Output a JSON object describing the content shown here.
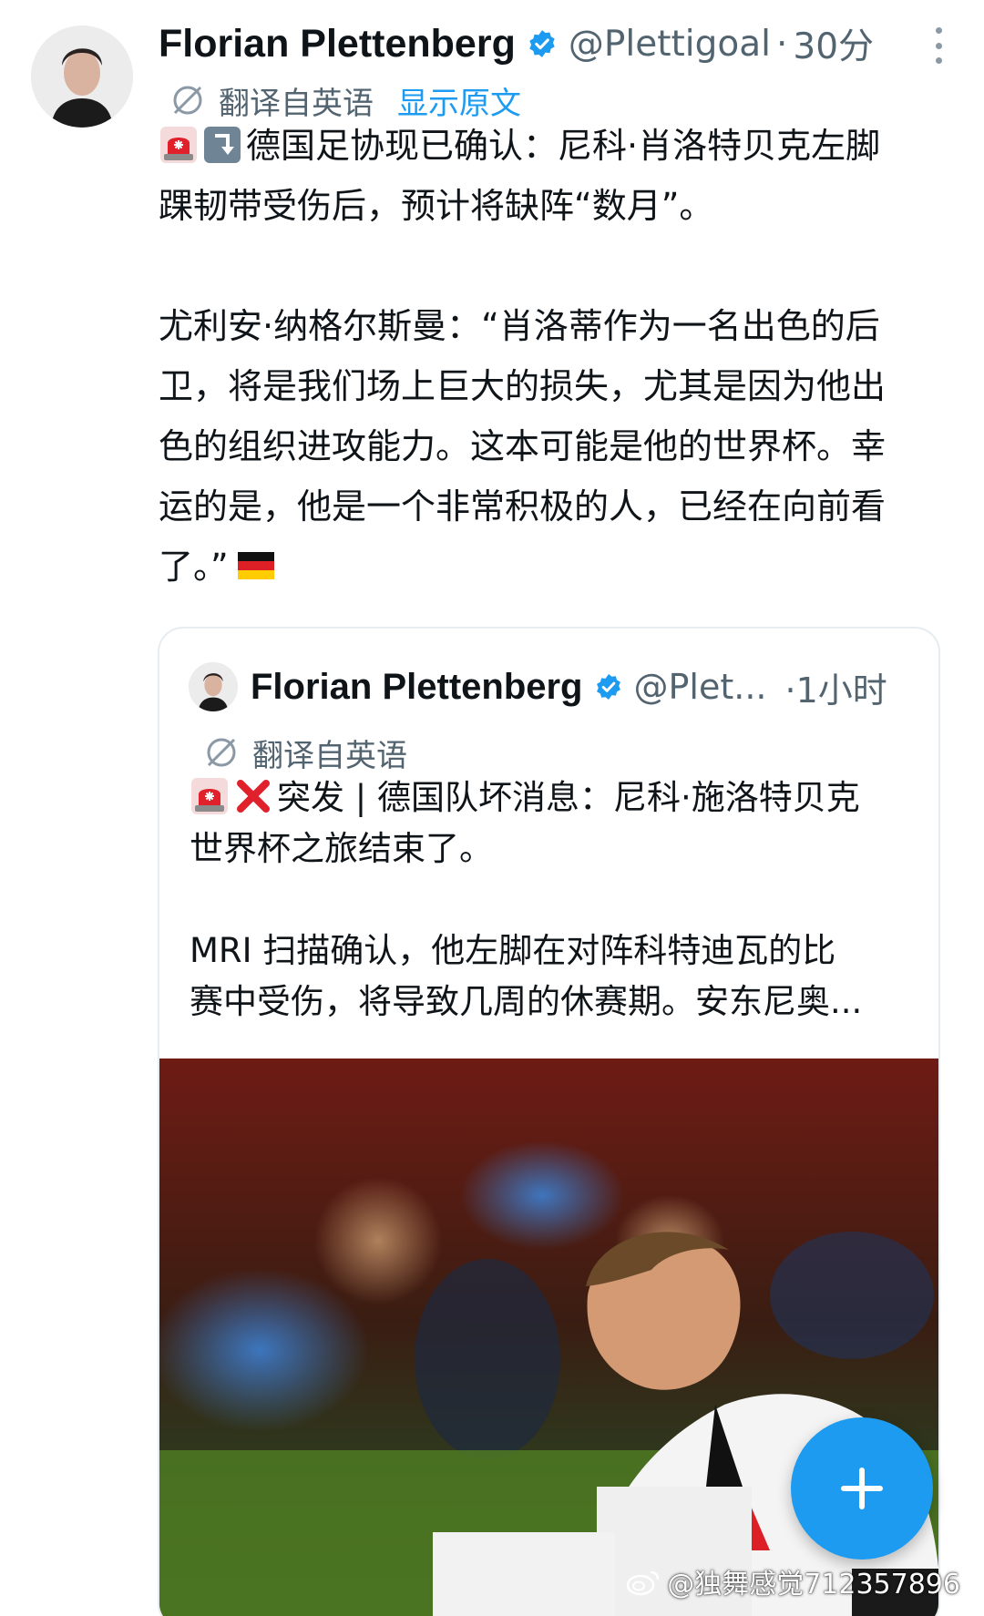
{
  "tweet": {
    "author_name": "Florian Plettenberg",
    "handle": "@Plettigoal",
    "separator": "·",
    "time": "30分",
    "translated_label": "翻译自英语",
    "show_original": "显示原文",
    "body_lines": [
      "德国足协现已确认：尼科·肖洛特贝克左脚",
      "踝韧带受伤后，预计将缺阵“数月”。",
      "尤利安·纳格尔斯曼：“肖洛蒂作为一名出色的后",
      "卫，将是我们场上巨大的损失，尤其是因为他出",
      "色的组织进攻能力。这本可能是他的世界杯。幸",
      "运的是，他是一个非常积极的人，已经在向前看",
      "了。”"
    ],
    "emojis": [
      "rotating-light-emoji",
      "down-arrow-emoji",
      "germany-flag-emoji"
    ]
  },
  "quoted_tweet": {
    "author_name": "Florian Plettenberg",
    "handle": "@Plet...",
    "time": "·1小时",
    "translated_label": "翻译自英语",
    "body_lines": [
      "突发 | 德国队坏消息：尼科·施洛特贝克",
      "世界杯之旅结束了。",
      "MRI 扫描确认，他左脚在对阵科特迪瓦的比",
      "赛中受伤，将导致几周的休赛期。安东尼奥..."
    ],
    "emojis": [
      "rotating-light-emoji",
      "cross-mark-emoji"
    ],
    "media_description": "photo"
  },
  "compose_button": {
    "icon": "plus-icon"
  },
  "watermark": {
    "text": "@独舞感觉712357896",
    "icon": "weibo-logo-icon"
  },
  "colors": {
    "accent": "#1d9bf0",
    "text": "#0f1419",
    "secondary": "#536471",
    "border": "#e6ecf0"
  }
}
